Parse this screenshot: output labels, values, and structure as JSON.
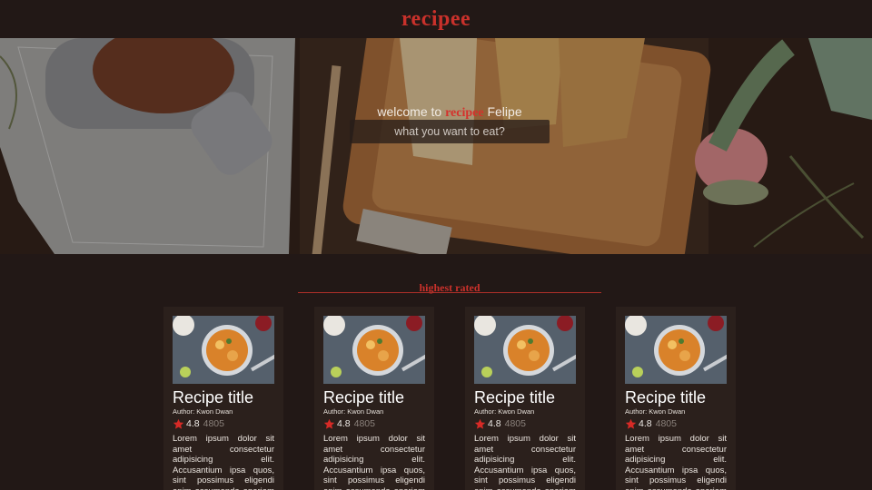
{
  "header": {
    "brand": "recipee"
  },
  "hero": {
    "welcome_prefix": "welcome to ",
    "welcome_brand": "recipee",
    "welcome_user": " Felipe",
    "search_placeholder": "what you want to eat?"
  },
  "section": {
    "title": "highest rated"
  },
  "cards": [
    {
      "title": "Recipe title",
      "author": "Author: Kwon Dwan",
      "rating": "4.8",
      "count": "4805",
      "description": "Lorem ipsum dolor sit amet consectetur adipisicing elit. Accusantium ipsa quos, sint possimus eligendi enim assumenda aperiam praesentium"
    },
    {
      "title": "Recipe title",
      "author": "Author: Kwon Dwan",
      "rating": "4.8",
      "count": "4805",
      "description": "Lorem ipsum dolor sit amet consectetur adipisicing elit. Accusantium ipsa quos, sint possimus eligendi enim assumenda aperiam praesentium"
    },
    {
      "title": "Recipe title",
      "author": "Author: Kwon Dwan",
      "rating": "4.8",
      "count": "4805",
      "description": "Lorem ipsum dolor sit amet consectetur adipisicing elit. Accusantium ipsa quos, sint possimus eligendi enim assumenda aperiam praesentium"
    },
    {
      "title": "Recipe title",
      "author": "Author: Kwon Dwan",
      "rating": "4.8",
      "count": "4805",
      "description": "Lorem ipsum dolor sit amet consectetur adipisicing elit. Accusantium ipsa quos, sint possimus eligendi enim assumenda aperiam praesentium"
    }
  ],
  "colors": {
    "brand": "#c9312b",
    "background": "#221816",
    "card": "#2b201c",
    "star": "#d62a26"
  },
  "icons": {
    "rating": "star-icon"
  }
}
